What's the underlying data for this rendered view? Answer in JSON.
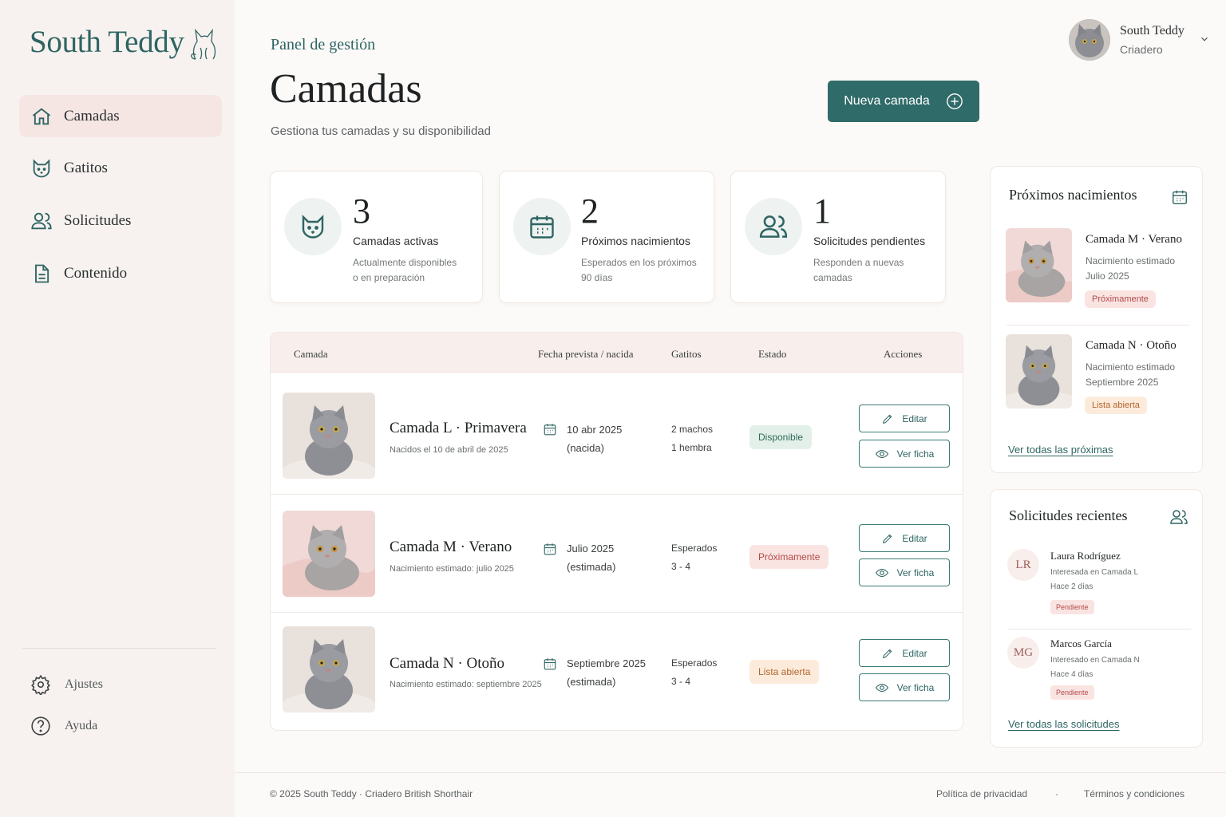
{
  "brand": {
    "name": "South Teddy"
  },
  "sidebar": {
    "items": [
      {
        "label": "Camadas",
        "icon": "home-icon",
        "active": true
      },
      {
        "label": "Gatitos",
        "icon": "cat-icon"
      },
      {
        "label": "Solicitudes",
        "icon": "users-icon"
      },
      {
        "label": "Contenido",
        "icon": "document-icon"
      }
    ],
    "bottom": [
      {
        "label": "Ajustes",
        "icon": "gear-icon"
      },
      {
        "label": "Ayuda",
        "icon": "help-icon"
      }
    ]
  },
  "header": {
    "eyebrow": "Panel de gestión",
    "title": "Camadas",
    "subtitle": "Gestiona tus camadas y su disponibilidad",
    "new_button": "Nueva camada"
  },
  "user": {
    "name": "South Teddy",
    "role": "Criadero"
  },
  "stats": [
    {
      "value": "3",
      "label": "Camadas activas",
      "desc1": "Actualmente disponibles",
      "desc2": "o en preparación",
      "icon": "cat-icon"
    },
    {
      "value": "2",
      "label": "Próximos nacimientos",
      "desc1": "Esperados en los próximos",
      "desc2": "90 días",
      "icon": "calendar-icon"
    },
    {
      "value": "1",
      "label": "Solicitudes pendientes",
      "desc1": "Responden a nuevas",
      "desc2": "camadas",
      "icon": "users-icon"
    }
  ],
  "table": {
    "headers": {
      "litter": "Camada",
      "date": "Fecha prevista / nacida",
      "kittens": "Gatitos",
      "status": "Estado",
      "actions": "Acciones"
    },
    "edit_label": "Editar",
    "view_label": "Ver ficha",
    "rows": [
      {
        "name": "Camada L · Primavera",
        "sub": "Nacidos el 10 de abril de 2025",
        "date1": "10 abr 2025",
        "date2": "(nacida)",
        "kits1": "2 machos",
        "kits2": "1 hembra",
        "status": "Disponible",
        "status_color": "#2e6b58"
      },
      {
        "name": "Camada M · Verano",
        "sub": "Nacimiento estimado: julio 2025",
        "date1": "Julio 2025",
        "date2": "(estimada)",
        "kits1": "Esperados",
        "kits2": "3 - 4",
        "status": "Próximamente",
        "status_color": "#b34b4b"
      },
      {
        "name": "Camada N · Otoño",
        "sub": "Nacimiento estimado: septiembre 2025",
        "date1": "Septiembre 2025",
        "date2": "(estimada)",
        "kits1": "Esperados",
        "kits2": "3 - 4",
        "status": "Lista abierta",
        "status_color": "#b0662e"
      }
    ]
  },
  "upcoming": {
    "title": "Próximos nacimientos",
    "items": [
      {
        "name": "Camada M · Verano",
        "d1": "Nacimiento estimado",
        "d2": "Julio 2025",
        "badge": "Próximamente"
      },
      {
        "name": "Camada N · Otoño",
        "d1": "Nacimiento estimado",
        "d2": "Septiembre 2025",
        "badge": "Lista abierta"
      }
    ],
    "link": "Ver todas las próximas"
  },
  "requests": {
    "title": "Solicitudes recientes",
    "items": [
      {
        "initials": "LR",
        "name": "Laura Rodríguez",
        "d1": "Interesada en Camada L",
        "d2": "Hace 2 días",
        "badge": "Pendiente"
      },
      {
        "initials": "MG",
        "name": "Marcos García",
        "d1": "Interesado en Camada N",
        "d2": "Hace 4 días",
        "badge": "Pendiente"
      }
    ],
    "link": "Ver todas las solicitudes"
  },
  "footer": {
    "copyright": "© 2025 South Teddy · Criadero British Shorthair",
    "privacy": "Política de privacidad",
    "sep": "·",
    "terms": "Términos y condiciones"
  },
  "colors": {
    "accent": "#2f6b68",
    "sidebar_bg": "#f7f2ef",
    "active_bg": "#f5e6e4"
  }
}
